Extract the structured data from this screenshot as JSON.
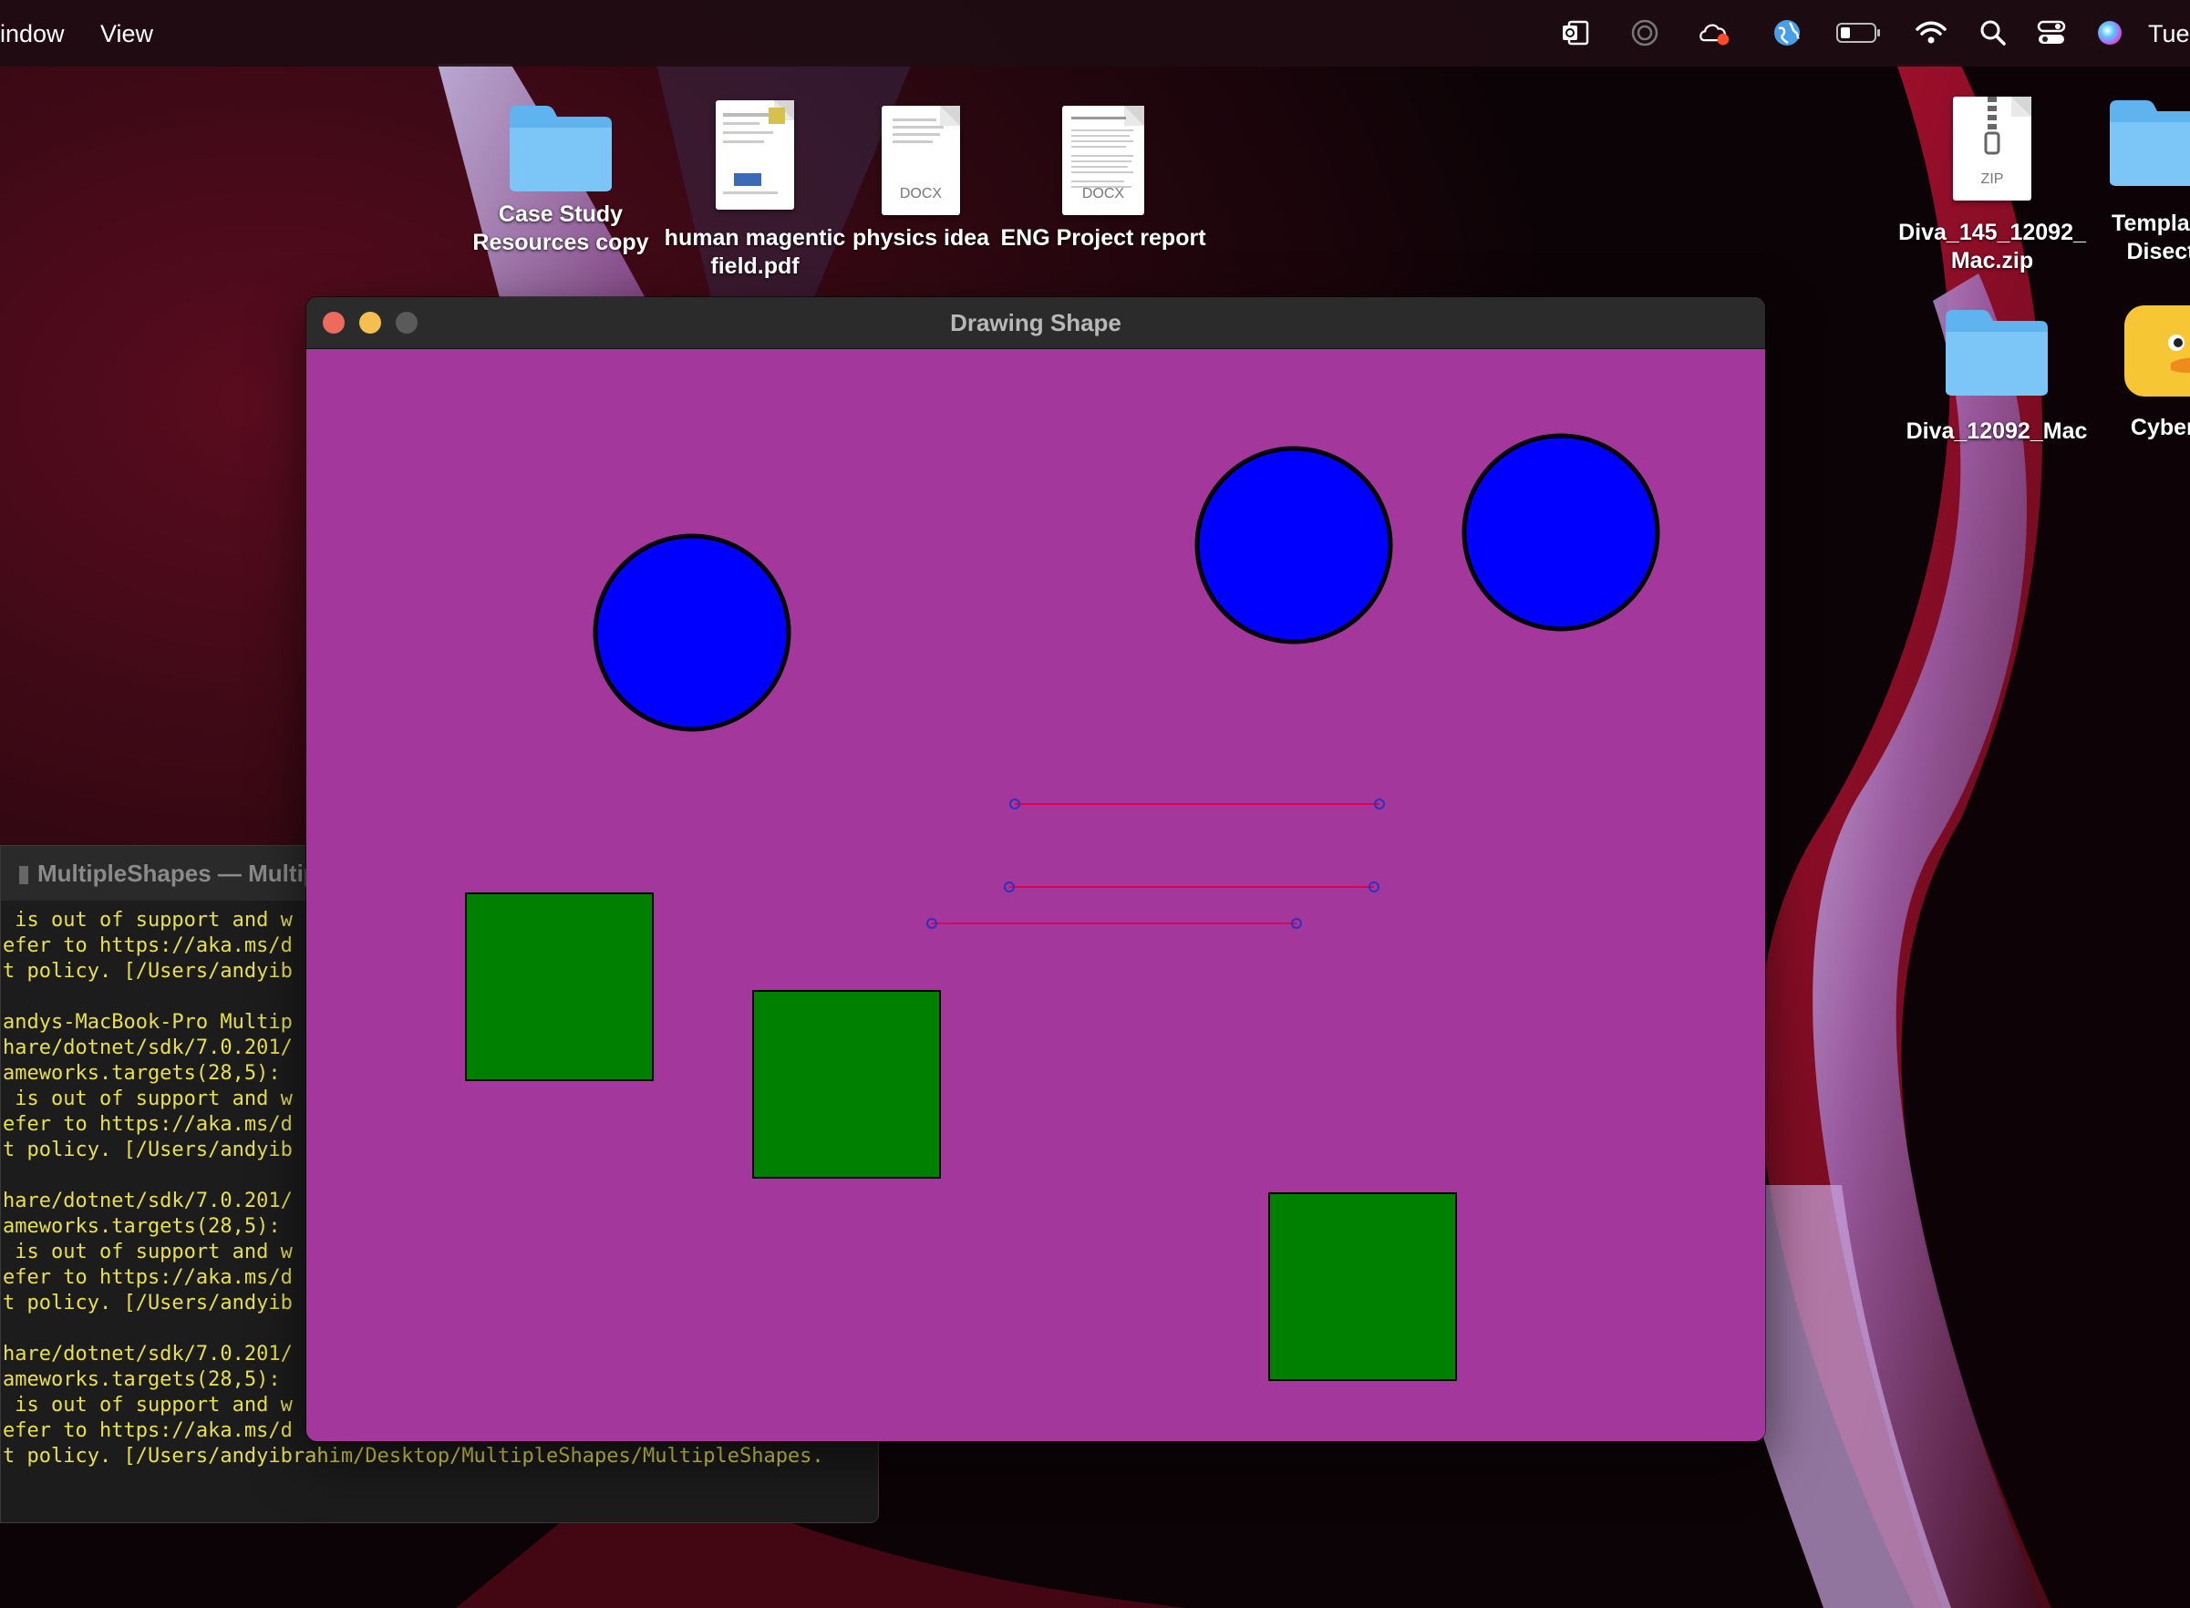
{
  "menubar": {
    "items": [
      "indow",
      "View"
    ],
    "clock": "Tue",
    "status_icons": [
      "outlook-icon",
      "activity-icon",
      "creative-cloud-icon",
      "globe-icon",
      "battery-icon",
      "wifi-icon",
      "spotlight-search-icon",
      "control-center-icon",
      "siri-icon"
    ]
  },
  "desktop": {
    "icons": [
      {
        "label": "Case Study\nResources copy",
        "kind": "folder"
      },
      {
        "label": "human magentic\nfield.pdf",
        "kind": "pdf"
      },
      {
        "label": "physics idea",
        "kind": "docx",
        "ext": "DOCX"
      },
      {
        "label": "ENG Project report",
        "kind": "docx",
        "ext": "DOCX"
      },
      {
        "label": "Diva_145_12092_\nMac.zip",
        "kind": "zip",
        "ext": "ZIP"
      },
      {
        "label": "Template\nDisect",
        "kind": "folder"
      },
      {
        "label": "Diva_12092_Mac",
        "kind": "folder"
      },
      {
        "label": "Cyberd",
        "kind": "app"
      }
    ]
  },
  "terminal": {
    "title": "MultipleShapes — Multip",
    "lines": [
      " is out of support and w",
      "efer to https://aka.ms/d",
      "t policy. [/Users/andyib",
      "",
      "andys-MacBook-Pro Multip",
      "hare/dotnet/sdk/7.0.201/",
      "ameworks.targets(28,5):",
      " is out of support and w",
      "efer to https://aka.ms/d",
      "t policy. [/Users/andyib",
      "",
      "hare/dotnet/sdk/7.0.201/",
      "ameworks.targets(28,5):",
      " is out of support and w",
      "efer to https://aka.ms/d",
      "t policy. [/Users/andyib",
      "",
      "hare/dotnet/sdk/7.0.201/",
      "ameworks.targets(28,5):",
      " is out of support and w",
      "efer to https://aka.ms/d",
      "t policy. [/Users/andyibrahim/Desktop/MultipleShapes/MultipleShapes."
    ]
  },
  "window": {
    "title": "Drawing Shape",
    "background_color": "#a4379c",
    "circle_fill": "#0000ff",
    "circle_outline": "#000000",
    "rect_fill": "#008000",
    "line_color": "#e0004a",
    "endpoint_color": "#3030c0",
    "shape_counts": {
      "circles": 3,
      "rectangles": 3,
      "lines": 3
    }
  }
}
